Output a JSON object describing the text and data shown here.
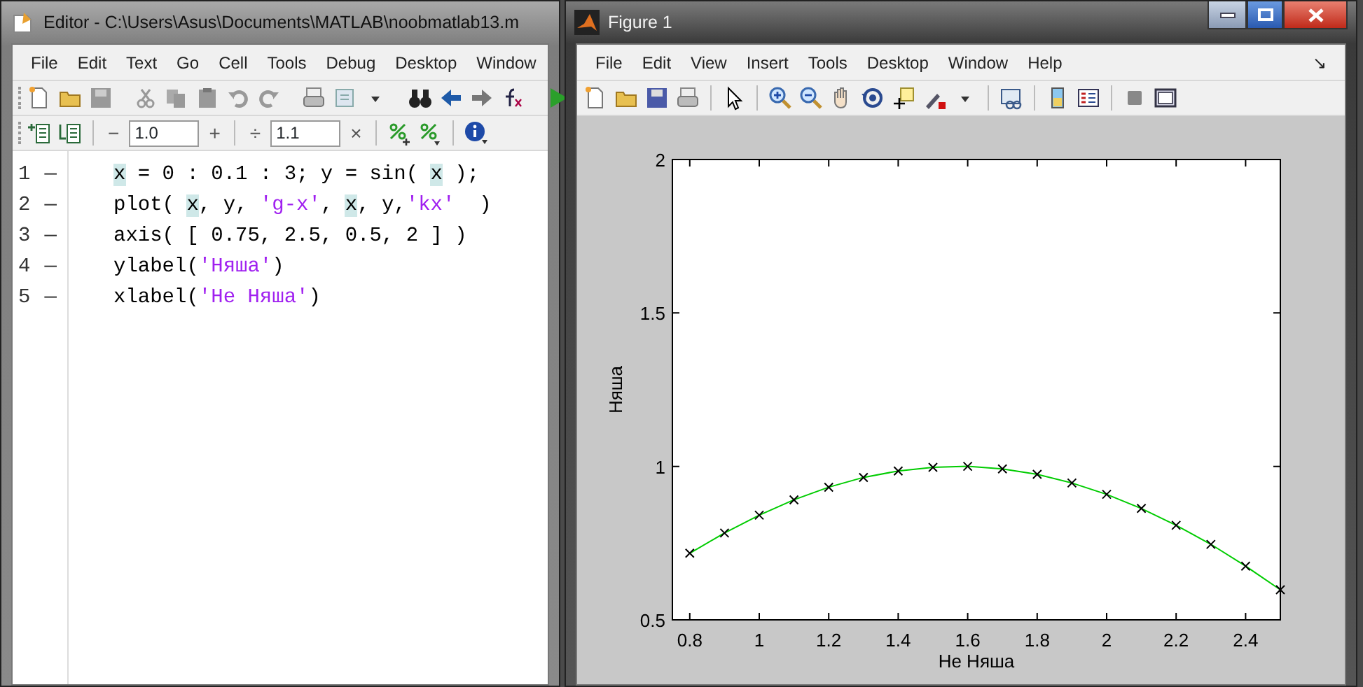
{
  "editor": {
    "title": "Editor - C:\\Users\\Asus\\Documents\\MATLAB\\noobmatlab13.m",
    "menu": [
      "File",
      "Edit",
      "Text",
      "Go",
      "Cell",
      "Tools",
      "Debug",
      "Desktop",
      "Window"
    ],
    "cell_toolbar": {
      "minus": "−",
      "decrement": "1.0",
      "plus": "+",
      "divide": "÷",
      "factor": "1.1",
      "times": "×"
    },
    "lines": [
      {
        "number": "1",
        "mark": "—",
        "tokens": [
          {
            "text": "x",
            "kind": "var"
          },
          {
            "text": " = 0 : 0.1 : 3; y = sin( ",
            "kind": "plain"
          },
          {
            "text": "x",
            "kind": "var"
          },
          {
            "text": " );",
            "kind": "plain"
          }
        ]
      },
      {
        "number": "2",
        "mark": "—",
        "tokens": [
          {
            "text": "plot( ",
            "kind": "plain"
          },
          {
            "text": "x",
            "kind": "var"
          },
          {
            "text": ", y, ",
            "kind": "plain"
          },
          {
            "text": "'g-x'",
            "kind": "string"
          },
          {
            "text": ", ",
            "kind": "plain"
          },
          {
            "text": "x",
            "kind": "var"
          },
          {
            "text": ", y,",
            "kind": "plain"
          },
          {
            "text": "'kx'",
            "kind": "string"
          },
          {
            "text": "  )",
            "kind": "plain"
          }
        ]
      },
      {
        "number": "3",
        "mark": "—",
        "tokens": [
          {
            "text": "axis( [ 0.75, 2.5, 0.5, 2 ] )",
            "kind": "plain"
          }
        ]
      },
      {
        "number": "4",
        "mark": "—",
        "tokens": [
          {
            "text": "ylabel(",
            "kind": "plain"
          },
          {
            "text": "'Няша'",
            "kind": "string"
          },
          {
            "text": ")",
            "kind": "plain"
          }
        ]
      },
      {
        "number": "5",
        "mark": "—",
        "tokens": [
          {
            "text": "xlabel(",
            "kind": "plain"
          },
          {
            "text": "'Не Няша'",
            "kind": "string"
          },
          {
            "text": ")",
            "kind": "plain"
          }
        ]
      }
    ]
  },
  "figure": {
    "title": "Figure 1",
    "menu": [
      "File",
      "Edit",
      "View",
      "Insert",
      "Tools",
      "Desktop",
      "Window",
      "Help"
    ],
    "dock": "↘",
    "chart_data": {
      "type": "line",
      "xlabel": "Не Няша",
      "ylabel": "Няша",
      "x": [
        0.8,
        0.9,
        1.0,
        1.1,
        1.2,
        1.3,
        1.4,
        1.5,
        1.6,
        1.7,
        1.8,
        1.9,
        2.0,
        2.1,
        2.2,
        2.3,
        2.4,
        2.5
      ],
      "series": [
        {
          "color": "#00cc00",
          "marker": "x",
          "values": [
            0.717,
            0.783,
            0.841,
            0.891,
            0.932,
            0.964,
            0.985,
            0.997,
            1.0,
            0.992,
            0.974,
            0.946,
            0.909,
            0.863,
            0.808,
            0.746,
            0.675,
            0.598
          ]
        }
      ],
      "xlim": [
        0.75,
        2.5
      ],
      "ylim": [
        0.5,
        2
      ],
      "xticks": [
        0.8,
        1,
        1.2,
        1.4,
        1.6,
        1.8,
        2,
        2.2,
        2.4
      ],
      "yticks": [
        0.5,
        1,
        1.5,
        2
      ]
    }
  }
}
